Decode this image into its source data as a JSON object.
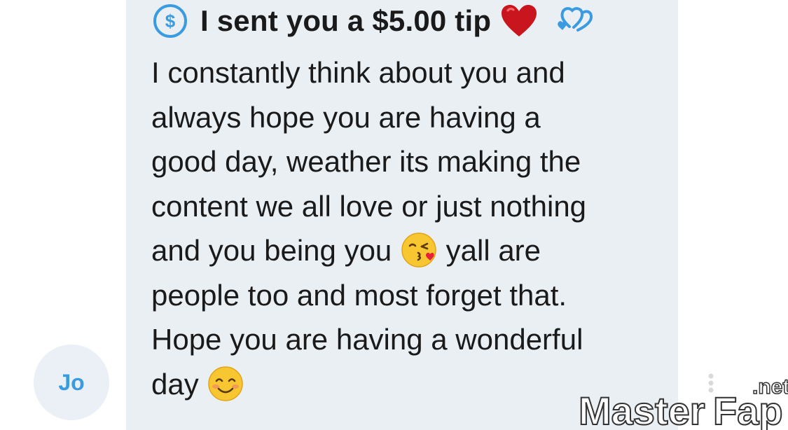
{
  "avatar": {
    "initials": "Jo"
  },
  "tip": {
    "icon": "dollar-circle-icon",
    "text": "I sent you a $5.00 tip",
    "emojis": [
      "red-heart",
      "blue-hearts"
    ]
  },
  "message": {
    "lines": [
      "I constantly think about you and",
      "always hope you are having a",
      "good day, weather its making the",
      "content we all love or just nothing",
      "and you being you",
      "yall are",
      "people too and most forget that.",
      "Hope you are having a wonderful",
      "day"
    ],
    "emojis": [
      "face-blowing-kiss",
      "smiling-face-with-smiling-eyes"
    ]
  },
  "watermark": {
    "brand_part1": "Master",
    "brand_part2": "Fap",
    "suffix": ".net"
  },
  "colors": {
    "bubble": "#eaeff3",
    "avatar_bg": "#eaf0f5",
    "accent_blue": "#3b9be0",
    "text": "#1a1a1a"
  }
}
